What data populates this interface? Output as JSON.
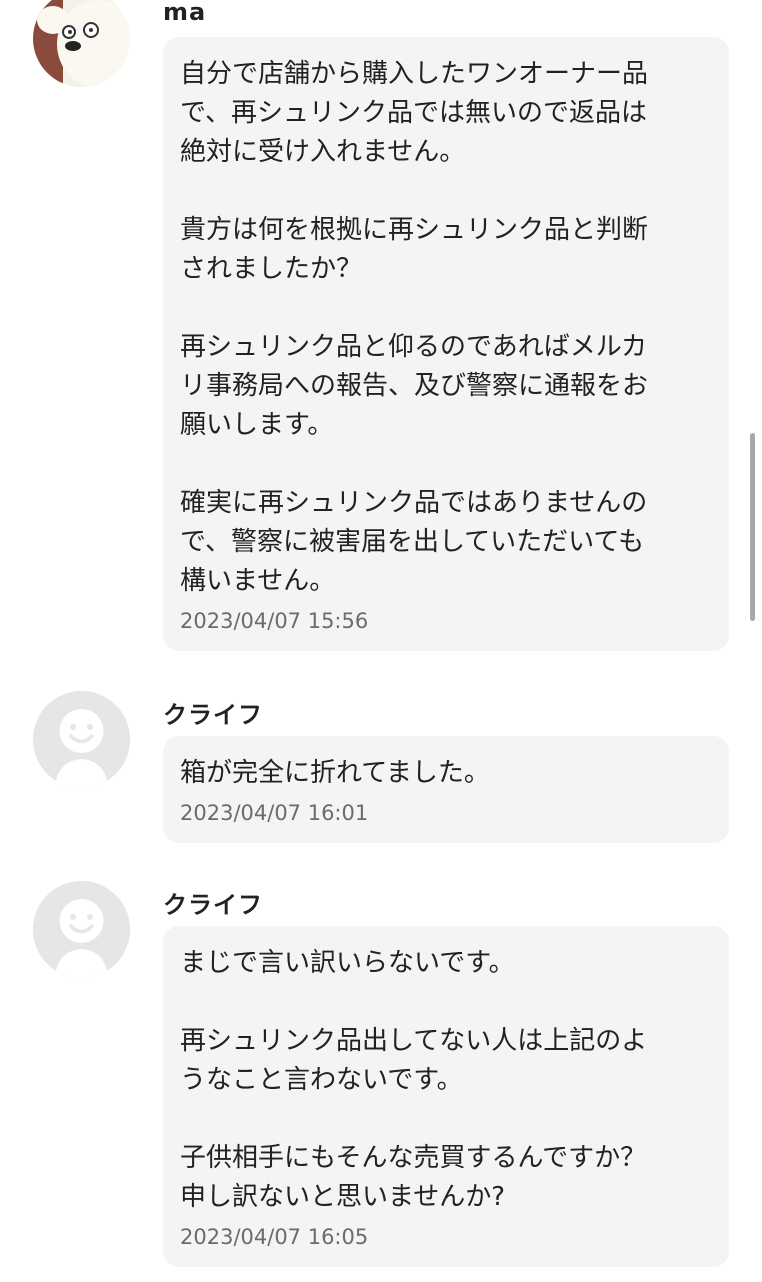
{
  "messages": [
    {
      "sender": "ma",
      "avatar": "custom-photo-avatar",
      "lines": [
        "自分で店舗から購入したワンオーナー品",
        "で、再シュリンク品では無いので返品は",
        "絶対に受け入れません。",
        "",
        "貴方は何を根拠に再シュリンク品と判断",
        "されましたか？",
        "",
        "再シュリンク品と仰るのであればメルカ",
        "リ事務局への報告、及び警察に通報をお",
        "願いします。",
        "",
        "確実に再シュリンク品ではありませんの",
        "で、警察に被害届を出していただいても",
        "構いません。"
      ],
      "timestamp": "2023/04/07 15:56"
    },
    {
      "sender": "クライフ",
      "avatar": "default-smiley-avatar",
      "lines": [
        "箱が完全に折れてました。"
      ],
      "timestamp": "2023/04/07 16:01"
    },
    {
      "sender": "クライフ",
      "avatar": "default-smiley-avatar",
      "lines": [
        "まじで言い訳いらないです。",
        "",
        "再シュリンク品出してない人は上記のよ",
        "うなこと言わないです。",
        "",
        "子供相手にもそんな売買するんですか？",
        "申し訳ないと思いませんか?"
      ],
      "timestamp": "2023/04/07 16:05"
    }
  ],
  "colors": {
    "bubble": "#f4f4f4",
    "timestamp": "#6b6b6b",
    "text": "#222222",
    "default_avatar_bg": "#e6e6e6",
    "default_avatar_face": "#ffffff"
  }
}
